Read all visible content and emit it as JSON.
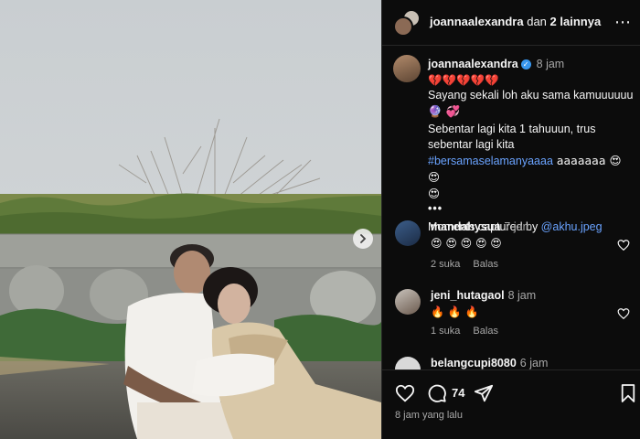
{
  "header": {
    "username": "joannaalexandra",
    "rest_text": " dan ",
    "others": "2 lainnya"
  },
  "caption": {
    "username": "joannaalexandra",
    "time": "8 jam",
    "line1": "💔💔💔💔💔",
    "line2": "Sayang sekali loh aku sama kamuuuuuu",
    "line3": "🔮 💞",
    "line4": "Sebentar lagi kita 1 tahuuun, trus sebentar lagi kita",
    "hashtag": "#bersamaselamanyaaaa",
    "line5": " aaaaaaa 😍 😍",
    "line6": "😍",
    "line7": "•••",
    "credit_prefix": "Moments captured by ",
    "credit_mention": "@akhu.jpeg"
  },
  "comments": [
    {
      "username": "mandahysua",
      "time": "7 jam",
      "text": "😍 😍 😍 😍 😍",
      "likes": "2 suka",
      "reply": "Balas"
    },
    {
      "username": "jeni_hutagaol",
      "time": "8 jam",
      "text": "🔥 🔥 🔥",
      "likes": "1 suka",
      "reply": "Balas"
    },
    {
      "username": "belangcupi8080",
      "time": "6 jam"
    }
  ],
  "footer": {
    "comment_count": "74",
    "time_ago": "8 jam yang lalu"
  },
  "colors": {
    "background": "#0c0c0c",
    "link": "#6aa3ff",
    "muted": "#a8a8a8",
    "verified": "#3897f0"
  },
  "icons": [
    "heart-icon",
    "comment-icon",
    "share-icon",
    "bookmark-icon",
    "chevron-right-icon",
    "more-icon"
  ]
}
